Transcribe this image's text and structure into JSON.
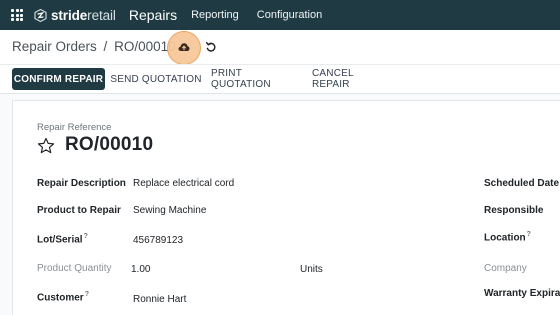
{
  "topnav": {
    "brand_bold": "stride",
    "brand_light": "retail",
    "app_name": "Repairs",
    "menus": [
      "Reporting",
      "Configuration"
    ]
  },
  "breadcrumb": {
    "parent": "Repair Orders",
    "separator": "/",
    "current": "RO/00010"
  },
  "status_buttons": {
    "confirm": "CONFIRM REPAIR",
    "send": "SEND QUOTATION",
    "print": "PRINT QUOTATION",
    "cancel": "CANCEL REPAIR"
  },
  "form": {
    "reference_label": "Repair Reference",
    "reference_value": "RO/00010",
    "left_fields": {
      "description_label": "Repair Description",
      "description_value": "Replace electrical cord",
      "product_label": "Product to Repair",
      "product_value": "Sewing Machine",
      "lot_label": "Lot/Serial",
      "lot_help": "?",
      "lot_value": "456789123",
      "qty_label": "Product Quantity",
      "qty_value": "1.00",
      "qty_uom": "Units",
      "customer_label": "Customer",
      "customer_help": "?",
      "customer_value": "Ronnie Hart"
    },
    "right_fields": {
      "scheduled_label": "Scheduled Date",
      "responsible_label": "Responsible",
      "location_label": "Location",
      "location_help": "?",
      "company_label": "Company",
      "warranty_label": "Warranty Expirati"
    }
  },
  "colors": {
    "nav_bg": "#1f3a43",
    "primary_button": "#1f3a43",
    "save_highlight": "#f7c89a"
  },
  "icons": {
    "apps": "apps-grid-icon",
    "brand": "stride-logo-icon",
    "save": "cloud-upload-icon",
    "discard": "undo-icon",
    "favorite": "star-outline-icon"
  }
}
